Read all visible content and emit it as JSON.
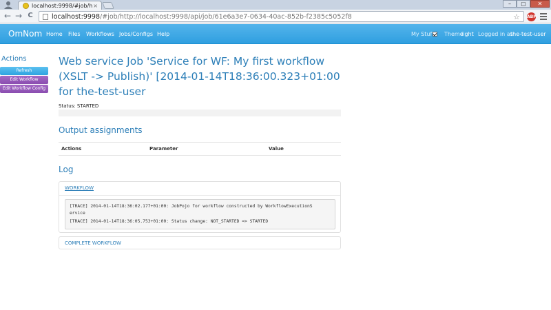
{
  "browser": {
    "tab_title": "localhost:9998/#job/h",
    "tab_close": "×",
    "address_host": "localhost:9998",
    "address_rest": "/#job/http://localhost:9998/api/job/61e6a3e7-0634-40ac-852b-f2385c5052f8",
    "star": "☆",
    "adblock_label": "ABP",
    "win_min": "–",
    "win_max": "▢",
    "win_close": "✕",
    "back": "←",
    "forward": "→",
    "reload": "C"
  },
  "navbar": {
    "brand": "OmNom",
    "links": [
      "Home",
      "Files",
      "Workflows",
      "Jobs/Configs",
      "Help"
    ],
    "my_stuff_label": "My Stuff",
    "my_stuff_checked": true,
    "theme_label": "Theme",
    "theme_value": "light",
    "logged_in_label": "Logged in as",
    "username": "the-test-user"
  },
  "sidebar": {
    "title": "Actions",
    "buttons": [
      "Refresh",
      "Edit Workflow",
      "Edit Workflow Config"
    ]
  },
  "main": {
    "title_lines": [
      "Web service Job 'Service for WF: My first workflow",
      "(XSLT -> Publish)' [2014-01-14T18:36:00.323+01:00",
      "for the-test-user"
    ],
    "status": "Status: STARTED",
    "output_heading": "Output assignments",
    "table_headers": [
      "Actions",
      "Parameter",
      "Value"
    ],
    "log_heading": "Log",
    "workflow_link": "WORKFLOW",
    "log_lines": [
      "[TRACE] 2014-01-14T18:36:02.177+01:00: JobPojo for workflow constructed by WorkflowExecutionS",
      "ervice",
      "[TRACE] 2014-01-14T18:36:05.753+01:00: Status change: NOT_STARTED => STARTED"
    ],
    "complete_workflow_link": "COMPLETE WORKFLOW"
  },
  "colors": {
    "navbar": "#3aa8e6",
    "link": "#2d7fb8",
    "button_blue": "#3aaae4",
    "button_purple": "#9557b9"
  }
}
